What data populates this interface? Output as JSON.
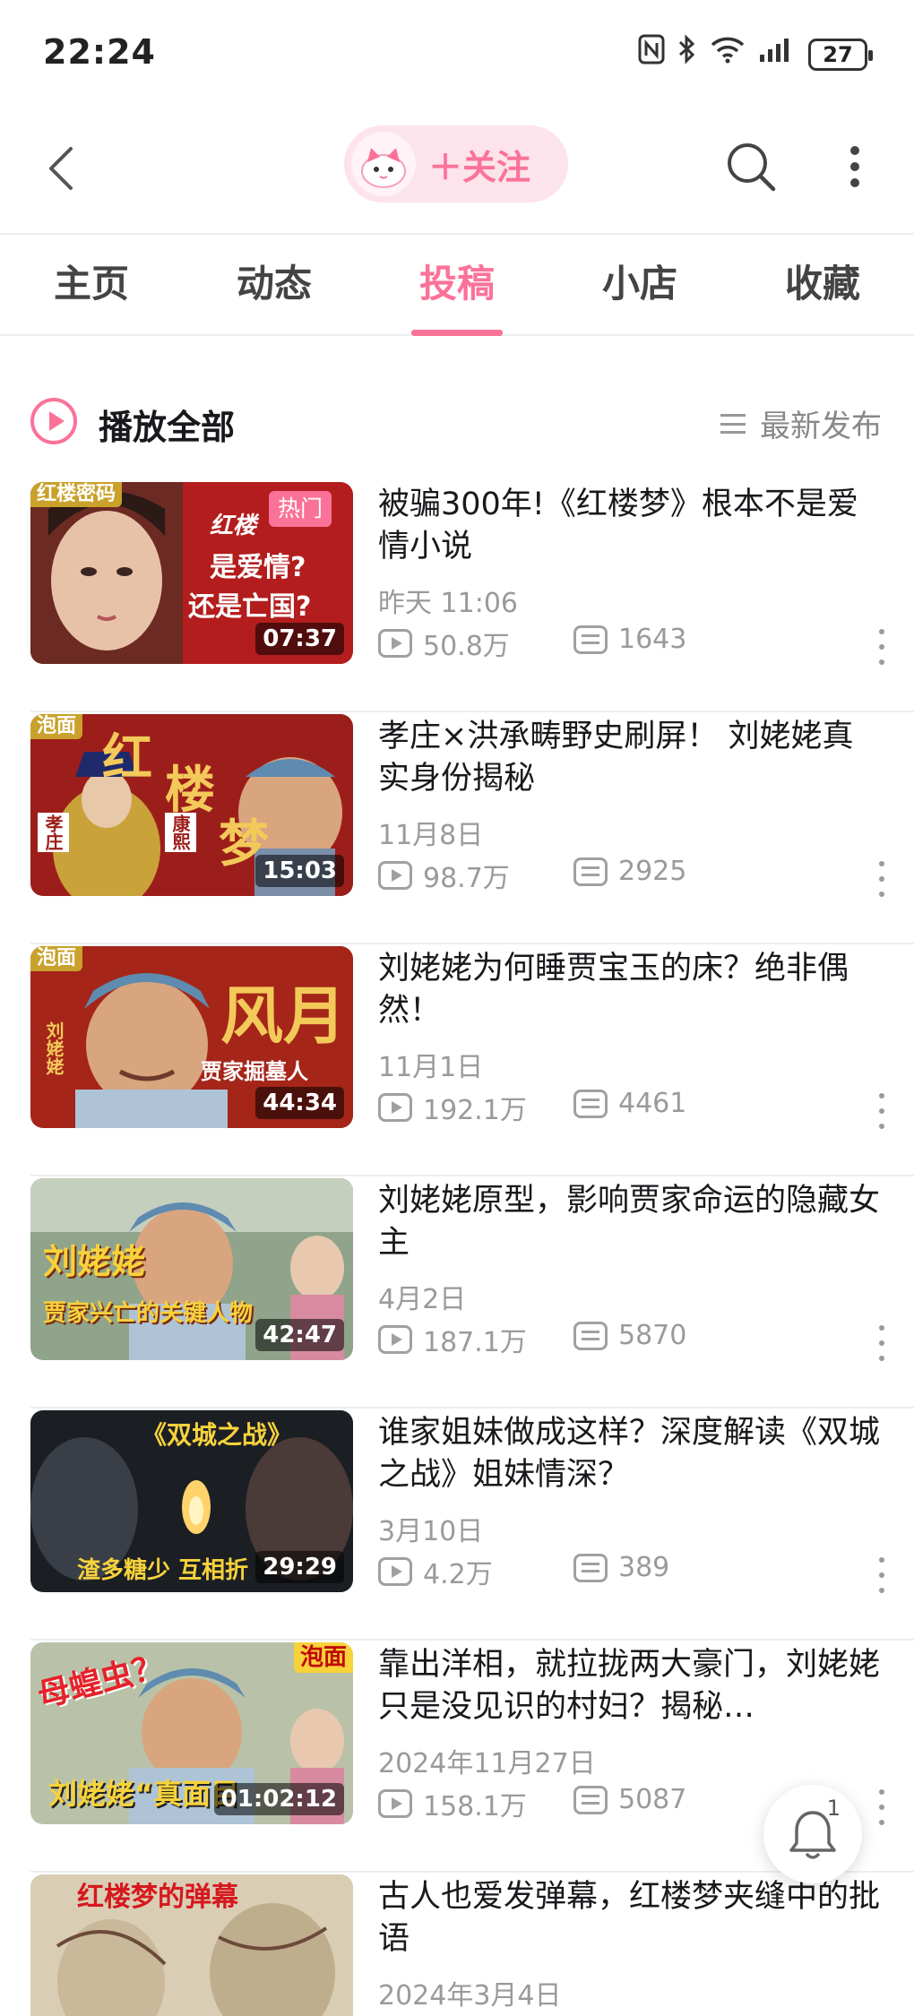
{
  "status_bar": {
    "time": "22:24",
    "battery": "27",
    "icons": [
      "nfc-icon",
      "bluetooth-icon",
      "wifi-icon",
      "signal-icon",
      "battery-icon"
    ]
  },
  "header": {
    "follow_label": "＋关注",
    "accent_color": "#fb7299"
  },
  "tabs": [
    {
      "label": "主页",
      "active": false
    },
    {
      "label": "动态",
      "active": false
    },
    {
      "label": "投稿",
      "active": true
    },
    {
      "label": "小店",
      "active": false
    },
    {
      "label": "收藏",
      "active": false
    }
  ],
  "play_all": {
    "label": "播放全部",
    "sort_label": "最新发布"
  },
  "videos": [
    {
      "title": "被骗300年!《红楼梦》根本不是爱情小说",
      "date": "昨天 11:06",
      "views": "50.8万",
      "comments": "1643",
      "duration": "07:37",
      "badge": "热门",
      "thumb_tag": "红楼密码",
      "thumb_text": [
        "红楼",
        "是爱情?",
        "还是亡国?"
      ]
    },
    {
      "title": "孝庄×洪承畴野史刷屏！ 刘姥姥真实身份揭秘",
      "date": "11月8日",
      "views": "98.7万",
      "comments": "2925",
      "duration": "15:03",
      "thumb_tag": "泡面",
      "thumb_text": [
        "红",
        "楼",
        "梦",
        "孝庄",
        "康熙"
      ]
    },
    {
      "title": "刘姥姥为何睡贾宝玉的床？绝非偶然！",
      "date": "11月1日",
      "views": "192.1万",
      "comments": "4461",
      "duration": "44:34",
      "thumb_tag": "泡面",
      "thumb_text": [
        "风月",
        "贾家掘墓人",
        "刘姥姥"
      ]
    },
    {
      "title": "刘姥姥原型，影响贾家命运的隐藏女主",
      "date": "4月2日",
      "views": "187.1万",
      "comments": "5870",
      "duration": "42:47",
      "thumb_text": [
        "刘姥姥",
        "贾家兴亡的关键人物"
      ]
    },
    {
      "title": "谁家姐妹做成这样？深度解读《双城之战》姐妹情深？",
      "date": "3月10日",
      "views": "4.2万",
      "comments": "389",
      "duration": "29:29",
      "thumb_text": [
        "《双城之战》",
        "渣多糖少 互相折"
      ]
    },
    {
      "title": "靠出洋相，就拉拢两大豪门，刘姥姥只是没见识的村妇？揭秘…",
      "date": "2024年11月27日",
      "views": "158.1万",
      "comments": "5087",
      "duration": "01:02:12",
      "thumb_tag": "泡面",
      "thumb_text": [
        "母蝗虫？",
        "刘姥姥“真面目"
      ]
    },
    {
      "title": "古人也爱发弹幕，红楼梦夹缝中的批语",
      "date": "2024年3月4日",
      "thumb_text": [
        "红楼梦的弹幕"
      ]
    }
  ],
  "notification": {
    "count": "1"
  }
}
